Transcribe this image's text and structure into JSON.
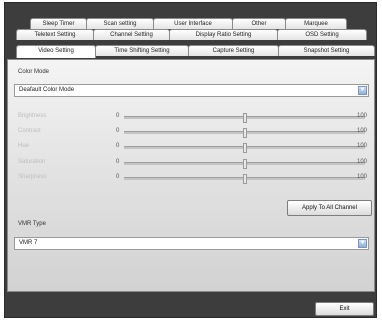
{
  "tabs": {
    "row1": [
      "Sleep Timer",
      "Scan setting",
      "User Interface",
      "Other",
      "Marquee"
    ],
    "row2": [
      "Teletext Setting",
      "Channel Setting",
      "Display Ratio Setting",
      "OSD Setting"
    ],
    "row3": [
      "Video Setting",
      "Time Shifting Setting",
      "Capture Setting",
      "Snapshot Setting"
    ],
    "active": "Video Setting"
  },
  "color_mode": {
    "label": "Color Mode",
    "value": "Deafault Color Mode",
    "arrow_icon": "chevron-down-icon"
  },
  "sliders": [
    {
      "label": "Brightness",
      "min": "0",
      "max": "100",
      "value": 50
    },
    {
      "label": "Contrast",
      "min": "0",
      "max": "100",
      "value": 50
    },
    {
      "label": "Hue",
      "min": "0",
      "max": "100",
      "value": 50
    },
    {
      "label": "Saturation",
      "min": "0",
      "max": "100",
      "value": 50
    },
    {
      "label": "Sharpness",
      "min": "0",
      "max": "100",
      "value": 50
    }
  ],
  "apply_button": "Apply To All Channel",
  "vmr": {
    "label": "VMR Type",
    "value": "VMR 7"
  },
  "exit_button": "Exit"
}
